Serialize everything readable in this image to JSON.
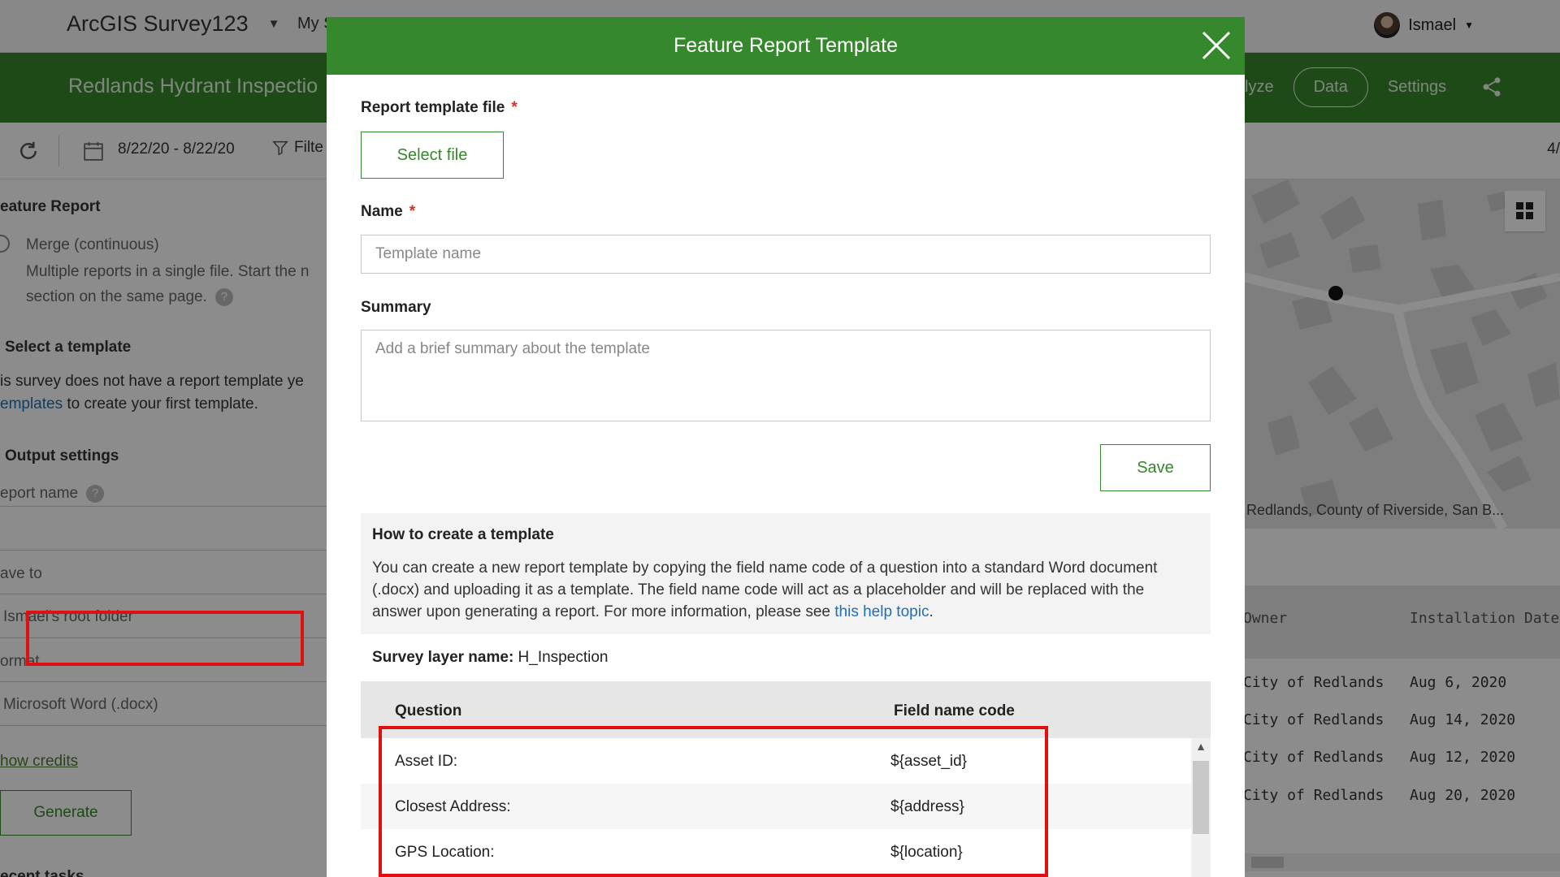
{
  "app": {
    "title": "ArcGIS Survey123",
    "my_surveys": "My S",
    "user": "Ismael"
  },
  "survey": {
    "title": "Redlands Hydrant Inspectio",
    "nav": {
      "analyze": "lyze",
      "data": "Data",
      "settings": "Settings"
    }
  },
  "toolbar": {
    "date_range": "8/22/20 - 8/22/20",
    "filter": "Filte",
    "pager": "4/"
  },
  "left_panel": {
    "heading": "eature Report",
    "merge_label": "Merge (continuous)",
    "merge_desc1": "Multiple reports in a single file. Start the n",
    "merge_desc2": "section on the same page.",
    "step2": "Select a template",
    "no_template1": "is survey does not have a report template ye",
    "no_template_link": "emplates",
    "no_template2": "to create your first template.",
    "step3": "Output settings",
    "report_name": "eport name",
    "save_to": "ave to",
    "save_to_value": "Ismael's root folder",
    "format": "ormat",
    "format_value": "Microsoft Word (.docx)",
    "show_credits": "how credits",
    "generate": "Generate",
    "recent_tasks": "ecent tasks"
  },
  "map": {
    "attribution": "Redlands, County of Riverside, San B..."
  },
  "right_table": {
    "headers": [
      "Owner",
      "Installation Date:"
    ],
    "rows": [
      [
        "City of Redlands",
        "Aug 6, 2020"
      ],
      [
        "City of Redlands",
        "Aug 14, 2020"
      ],
      [
        "City of Redlands",
        "Aug 12, 2020"
      ],
      [
        "City of Redlands",
        "Aug 20, 2020"
      ]
    ]
  },
  "modal": {
    "title": "Feature Report Template",
    "template_file_label": "Report template file",
    "required_mark": "*",
    "select_file": "Select file",
    "name_label": "Name",
    "name_placeholder": "Template name",
    "summary_label": "Summary",
    "summary_placeholder": "Add a brief summary about the template",
    "save": "Save",
    "how_title": "How to create a template",
    "how_text": "You can create a new report template by copying the field name code of a question into a standard Word document (.docx) and uploading it as a template. The field name code will act as a placeholder and will be replaced with the answer upon generating a report. For more information, please see",
    "how_link": "this help topic",
    "how_end": ".",
    "layer_label": "Survey layer name:",
    "layer_value": "H_Inspection",
    "table_headers": {
      "question": "Question",
      "field_code": "Field name code"
    },
    "table_rows": [
      {
        "question": "Asset ID:",
        "code": "${asset_id}"
      },
      {
        "question": "Closest Address:",
        "code": "${address}"
      },
      {
        "question": "GPS Location:",
        "code": "${location}"
      }
    ]
  },
  "colors": {
    "brand_green": "#35882b",
    "highlight_red": "#e01010",
    "link_blue": "#1f6fb7",
    "required_red": "#d83020"
  }
}
